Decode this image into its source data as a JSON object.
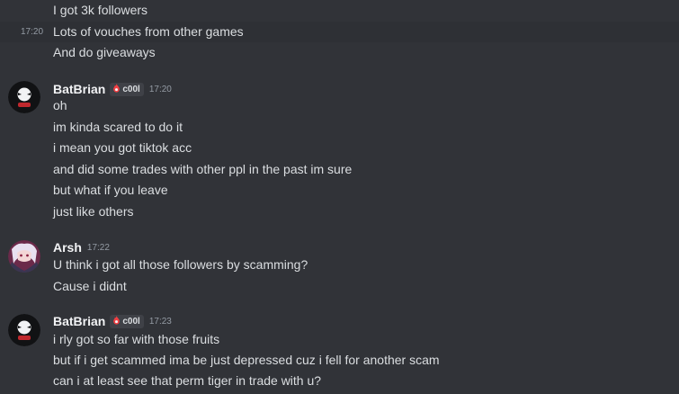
{
  "group1": {
    "lines": [
      {
        "text": "I got 3k followers"
      },
      {
        "text": "Lots of vouches from other games",
        "timestamp": "17:20"
      },
      {
        "text": "And do giveaways"
      }
    ]
  },
  "group2": {
    "author": "BatBrian",
    "badge": "c00l",
    "time": "17:20",
    "lines": [
      "oh",
      "im kinda scared to do it",
      "i mean you got tiktok acc",
      "and did some trades with other ppl in the past im sure",
      "but what if you leave",
      "just like others"
    ]
  },
  "group3": {
    "author": "Arsh",
    "time": "17:22",
    "lines": [
      "U think i got all those followers by scamming?",
      "Cause i didnt"
    ]
  },
  "group4": {
    "author": "BatBrian",
    "badge": "c00l",
    "time": "17:23",
    "lines": [
      "i rly got so far with those fruits",
      "but if i get scammed ima be just depressed cuz i fell for another scam",
      "can i at least see that perm tiger in trade with u?"
    ]
  },
  "icons": {
    "badge_icon": "flame-icon",
    "avatar_batbrian": "batbrian-avatar",
    "avatar_arsh": "arsh-avatar"
  },
  "colors": {
    "background": "#313338",
    "hover_row": "#2e3035",
    "text": "#dbdee1",
    "muted": "#949ba4",
    "username": "#f2f3f5",
    "badge_bg": "#3f4147",
    "flame": "#f23f43"
  }
}
